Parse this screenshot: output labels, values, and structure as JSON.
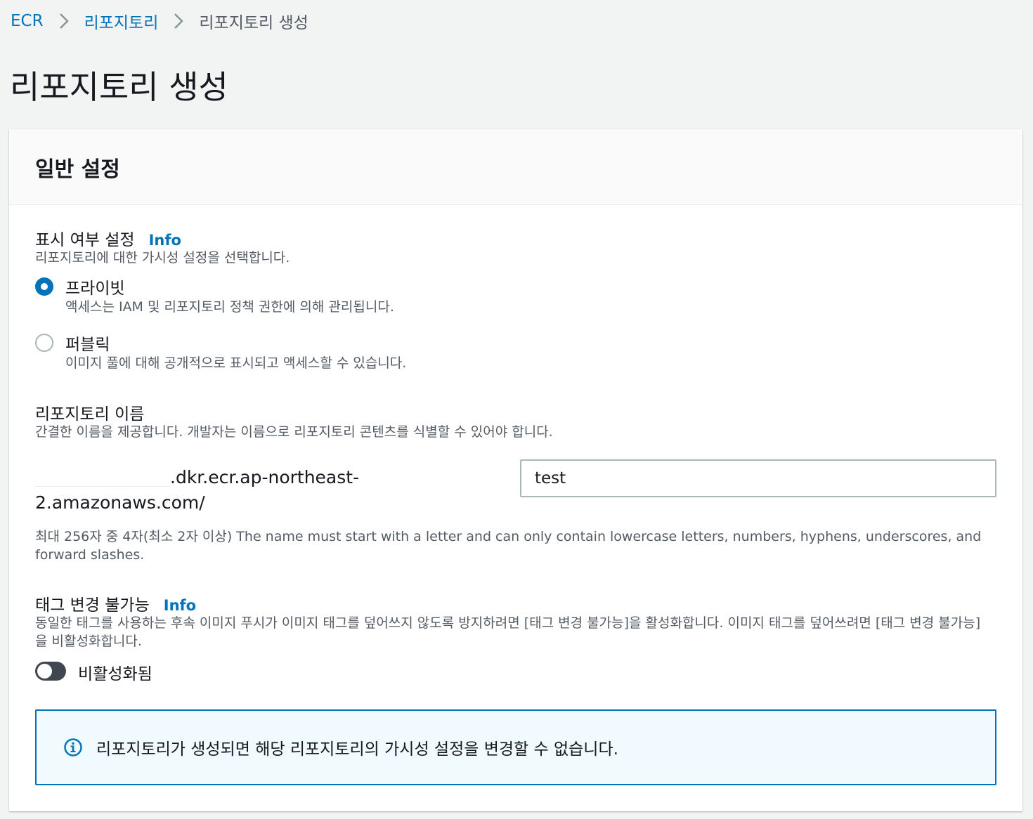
{
  "breadcrumb": {
    "items": [
      "ECR",
      "리포지토리",
      "리포지토리 생성"
    ]
  },
  "page": {
    "title": "리포지토리 생성"
  },
  "general_settings": {
    "title": "일반 설정",
    "visibility": {
      "label": "표시 여부 설정",
      "info": "Info",
      "description": "리포지토리에 대한 가시성 설정을 선택합니다.",
      "options": [
        {
          "label": "프라이빗",
          "description": "액세스는 IAM 및 리포지토리 정책 권한에 의해 관리됩니다.",
          "selected": true
        },
        {
          "label": "퍼블릭",
          "description": "이미지 풀에 대해 공개적으로 표시되고 액세스할 수 있습니다.",
          "selected": false
        }
      ]
    },
    "repo_name": {
      "label": "리포지토리 이름",
      "description": "간결한 이름을 제공합니다. 개발자는 이름으로 리포지토리 콘텐츠를 식별할 수 있어야 합니다.",
      "uri_prefix_line1": ".dkr.ecr.ap-northeast-",
      "uri_prefix_line2": "2.amazonaws.com/",
      "value": "test",
      "constraint": "최대 256자 중 4자(최소 2자 이상) The name must start with a letter and can only contain lowercase letters, numbers, hyphens, underscores, and forward slashes."
    },
    "tag_immutability": {
      "label": "태그 변경 불가능",
      "info": "Info",
      "description": "동일한 태그를 사용하는 후속 이미지 푸시가 이미지 태그를 덮어쓰지 않도록 방지하려면 [태그 변경 불가능]을 활성화합니다. 이미지 태그를 덮어쓰려면 [태그 변경 불가능]을 비활성화합니다.",
      "toggle_state": "비활성화됨",
      "enabled": false
    },
    "alert": {
      "text": "리포지토리가 생성되면 해당 리포지토리의 가시성 설정을 변경할 수 없습니다."
    }
  },
  "colors": {
    "link": "#0073bb",
    "background": "#f2f3f3",
    "alert_border": "#0073bb",
    "alert_background": "#f1faff"
  }
}
